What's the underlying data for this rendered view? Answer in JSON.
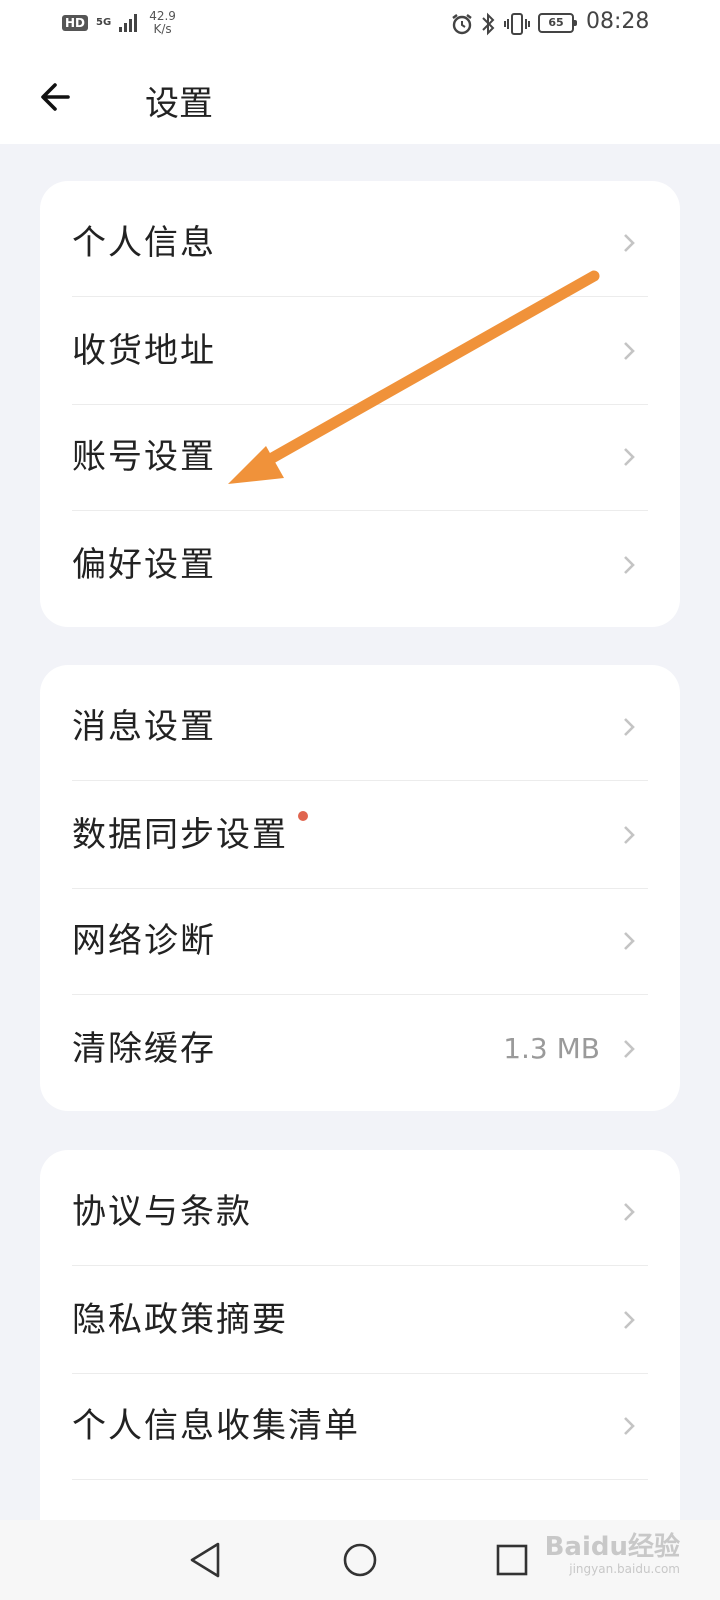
{
  "status_bar": {
    "hd": "HD",
    "network": "5G",
    "speed_value": "42.9",
    "speed_unit": "K/s",
    "battery_level": "65",
    "time": "08:28",
    "icons": [
      "alarm-icon",
      "bluetooth-icon",
      "vibrate-icon",
      "battery-icon"
    ]
  },
  "header": {
    "title": "设置",
    "back_icon": "back-arrow-icon"
  },
  "groups": [
    {
      "items": [
        {
          "label": "个人信息"
        },
        {
          "label": "收货地址"
        },
        {
          "label": "账号设置"
        },
        {
          "label": "偏好设置"
        }
      ]
    },
    {
      "items": [
        {
          "label": "消息设置"
        },
        {
          "label": "数据同步设置",
          "badge_dot": true
        },
        {
          "label": "网络诊断"
        },
        {
          "label": "清除缓存",
          "value": "1.3 MB"
        }
      ]
    },
    {
      "items": [
        {
          "label": "协议与条款"
        },
        {
          "label": "隐私政策摘要"
        },
        {
          "label": "个人信息收集清单"
        }
      ]
    }
  ],
  "annotation": {
    "type": "arrow",
    "color": "#f0923a",
    "points_to": "账号设置"
  },
  "nav_bar": {
    "icons": [
      "nav-back-icon",
      "nav-home-icon",
      "nav-recents-icon"
    ]
  },
  "watermark": {
    "main": "Baidu经验",
    "sub": "jingyan.baidu.com"
  },
  "colors": {
    "background": "#f2f3f8",
    "card": "#ffffff",
    "text": "#222222",
    "secondary_text": "#9a9a9a",
    "badge_dot": "#e0654f"
  }
}
